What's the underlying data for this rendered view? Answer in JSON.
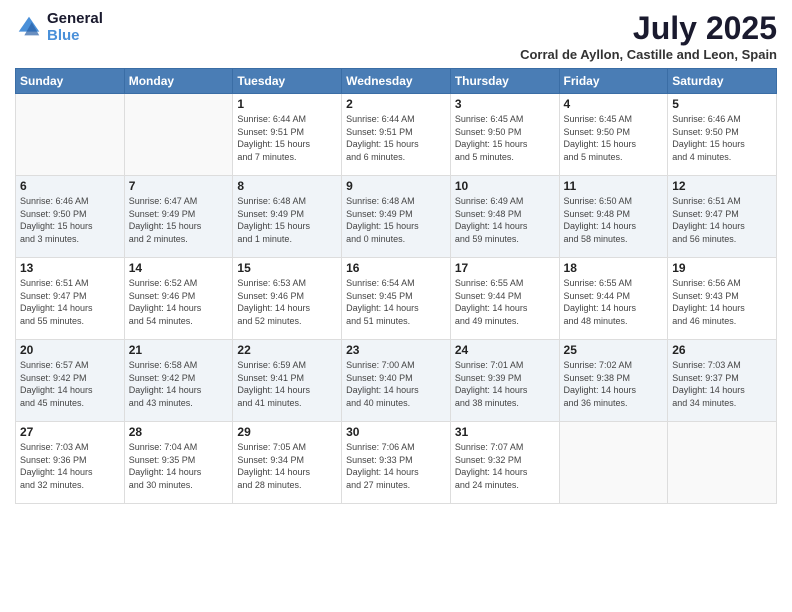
{
  "logo": {
    "line1": "General",
    "line2": "Blue"
  },
  "title": "July 2025",
  "subtitle": "Corral de Ayllon, Castille and Leon, Spain",
  "headers": [
    "Sunday",
    "Monday",
    "Tuesday",
    "Wednesday",
    "Thursday",
    "Friday",
    "Saturday"
  ],
  "weeks": [
    [
      {
        "num": "",
        "info": ""
      },
      {
        "num": "",
        "info": ""
      },
      {
        "num": "1",
        "info": "Sunrise: 6:44 AM\nSunset: 9:51 PM\nDaylight: 15 hours\nand 7 minutes."
      },
      {
        "num": "2",
        "info": "Sunrise: 6:44 AM\nSunset: 9:51 PM\nDaylight: 15 hours\nand 6 minutes."
      },
      {
        "num": "3",
        "info": "Sunrise: 6:45 AM\nSunset: 9:50 PM\nDaylight: 15 hours\nand 5 minutes."
      },
      {
        "num": "4",
        "info": "Sunrise: 6:45 AM\nSunset: 9:50 PM\nDaylight: 15 hours\nand 5 minutes."
      },
      {
        "num": "5",
        "info": "Sunrise: 6:46 AM\nSunset: 9:50 PM\nDaylight: 15 hours\nand 4 minutes."
      }
    ],
    [
      {
        "num": "6",
        "info": "Sunrise: 6:46 AM\nSunset: 9:50 PM\nDaylight: 15 hours\nand 3 minutes."
      },
      {
        "num": "7",
        "info": "Sunrise: 6:47 AM\nSunset: 9:49 PM\nDaylight: 15 hours\nand 2 minutes."
      },
      {
        "num": "8",
        "info": "Sunrise: 6:48 AM\nSunset: 9:49 PM\nDaylight: 15 hours\nand 1 minute."
      },
      {
        "num": "9",
        "info": "Sunrise: 6:48 AM\nSunset: 9:49 PM\nDaylight: 15 hours\nand 0 minutes."
      },
      {
        "num": "10",
        "info": "Sunrise: 6:49 AM\nSunset: 9:48 PM\nDaylight: 14 hours\nand 59 minutes."
      },
      {
        "num": "11",
        "info": "Sunrise: 6:50 AM\nSunset: 9:48 PM\nDaylight: 14 hours\nand 58 minutes."
      },
      {
        "num": "12",
        "info": "Sunrise: 6:51 AM\nSunset: 9:47 PM\nDaylight: 14 hours\nand 56 minutes."
      }
    ],
    [
      {
        "num": "13",
        "info": "Sunrise: 6:51 AM\nSunset: 9:47 PM\nDaylight: 14 hours\nand 55 minutes."
      },
      {
        "num": "14",
        "info": "Sunrise: 6:52 AM\nSunset: 9:46 PM\nDaylight: 14 hours\nand 54 minutes."
      },
      {
        "num": "15",
        "info": "Sunrise: 6:53 AM\nSunset: 9:46 PM\nDaylight: 14 hours\nand 52 minutes."
      },
      {
        "num": "16",
        "info": "Sunrise: 6:54 AM\nSunset: 9:45 PM\nDaylight: 14 hours\nand 51 minutes."
      },
      {
        "num": "17",
        "info": "Sunrise: 6:55 AM\nSunset: 9:44 PM\nDaylight: 14 hours\nand 49 minutes."
      },
      {
        "num": "18",
        "info": "Sunrise: 6:55 AM\nSunset: 9:44 PM\nDaylight: 14 hours\nand 48 minutes."
      },
      {
        "num": "19",
        "info": "Sunrise: 6:56 AM\nSunset: 9:43 PM\nDaylight: 14 hours\nand 46 minutes."
      }
    ],
    [
      {
        "num": "20",
        "info": "Sunrise: 6:57 AM\nSunset: 9:42 PM\nDaylight: 14 hours\nand 45 minutes."
      },
      {
        "num": "21",
        "info": "Sunrise: 6:58 AM\nSunset: 9:42 PM\nDaylight: 14 hours\nand 43 minutes."
      },
      {
        "num": "22",
        "info": "Sunrise: 6:59 AM\nSunset: 9:41 PM\nDaylight: 14 hours\nand 41 minutes."
      },
      {
        "num": "23",
        "info": "Sunrise: 7:00 AM\nSunset: 9:40 PM\nDaylight: 14 hours\nand 40 minutes."
      },
      {
        "num": "24",
        "info": "Sunrise: 7:01 AM\nSunset: 9:39 PM\nDaylight: 14 hours\nand 38 minutes."
      },
      {
        "num": "25",
        "info": "Sunrise: 7:02 AM\nSunset: 9:38 PM\nDaylight: 14 hours\nand 36 minutes."
      },
      {
        "num": "26",
        "info": "Sunrise: 7:03 AM\nSunset: 9:37 PM\nDaylight: 14 hours\nand 34 minutes."
      }
    ],
    [
      {
        "num": "27",
        "info": "Sunrise: 7:03 AM\nSunset: 9:36 PM\nDaylight: 14 hours\nand 32 minutes."
      },
      {
        "num": "28",
        "info": "Sunrise: 7:04 AM\nSunset: 9:35 PM\nDaylight: 14 hours\nand 30 minutes."
      },
      {
        "num": "29",
        "info": "Sunrise: 7:05 AM\nSunset: 9:34 PM\nDaylight: 14 hours\nand 28 minutes."
      },
      {
        "num": "30",
        "info": "Sunrise: 7:06 AM\nSunset: 9:33 PM\nDaylight: 14 hours\nand 27 minutes."
      },
      {
        "num": "31",
        "info": "Sunrise: 7:07 AM\nSunset: 9:32 PM\nDaylight: 14 hours\nand 24 minutes."
      },
      {
        "num": "",
        "info": ""
      },
      {
        "num": "",
        "info": ""
      }
    ]
  ]
}
